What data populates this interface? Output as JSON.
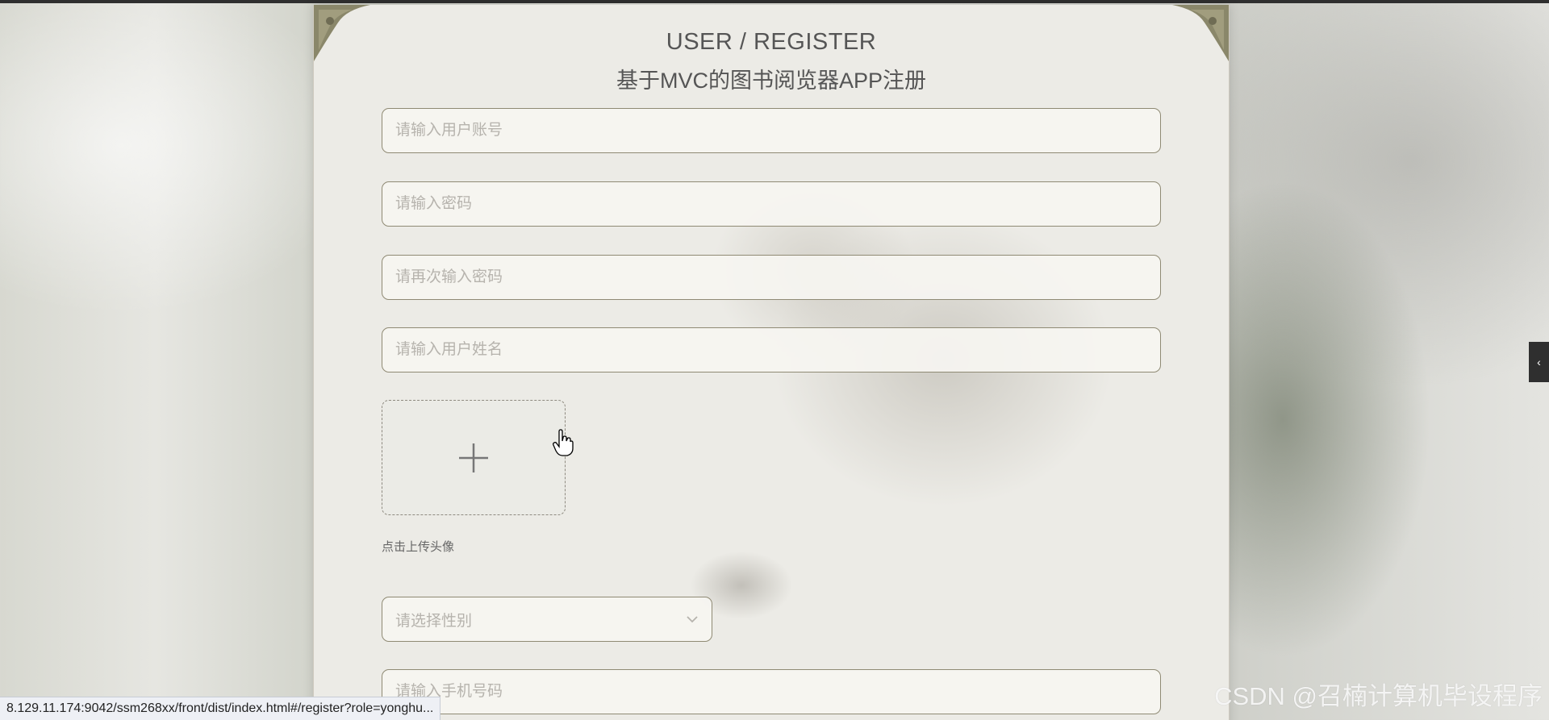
{
  "page": {
    "title_en": "USER / REGISTER",
    "title_zh": "基于MVC的图书阅览器APP注册"
  },
  "form": {
    "account_placeholder": "请输入用户账号",
    "password_placeholder": "请输入密码",
    "confirm_placeholder": "请再次输入密码",
    "name_placeholder": "请输入用户姓名",
    "avatar_label": "点击上传头像",
    "gender_placeholder": "请选择性别",
    "phone_placeholder": "请输入手机号码"
  },
  "browser": {
    "status_url": "8.129.11.174:9042/ssm268xx/front/dist/index.html#/register?role=yonghu...",
    "side_tab_glyph": "‹"
  },
  "watermark": {
    "text": "CSDN @召楠计算机毕设程序"
  },
  "icons": {
    "upload": "plus-icon",
    "select": "chevron-down-icon",
    "cursor": "hand-pointer-icon",
    "corners": "corner-ornament-icon"
  },
  "colors": {
    "border": "#8f8a74",
    "panel": "#ecebe6",
    "title": "#555555",
    "placeholder": "#b6b3ad"
  }
}
